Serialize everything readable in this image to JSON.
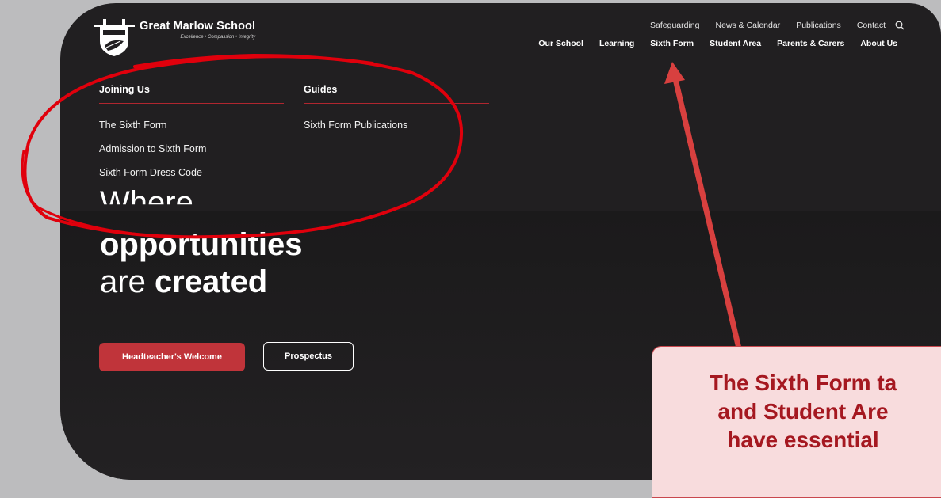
{
  "site": {
    "name": "Great Marlow School",
    "tagline": "Excellence • Compassion • Integrity"
  },
  "util_nav": [
    "Safeguarding",
    "News & Calendar",
    "Publications",
    "Contact"
  ],
  "main_nav": [
    "Our School",
    "Learning",
    "Sixth Form",
    "Student Area",
    "Parents & Carers",
    "About Us"
  ],
  "dropdown": {
    "joining": {
      "heading": "Joining Us",
      "links": [
        "The Sixth Form",
        "Admission to Sixth Form",
        "Sixth Form Dress Code"
      ]
    },
    "guides": {
      "heading": "Guides",
      "links": [
        "Sixth Form Publications"
      ]
    }
  },
  "hero": {
    "line1": "Where",
    "line2": "opportunities",
    "line3_plain": "are ",
    "line3_bold": "created"
  },
  "buttons": {
    "welcome": "Headteacher's Welcome",
    "prospectus": "Prospectus"
  },
  "annotation": {
    "line1": "The Sixth Form ta",
    "line2": "and Student Are",
    "line3": "have essential"
  },
  "colors": {
    "background": "#211f21",
    "accent_red": "#c0343a",
    "annotation_red": "#e0000c",
    "annotation_box": "#f8dcdd"
  }
}
